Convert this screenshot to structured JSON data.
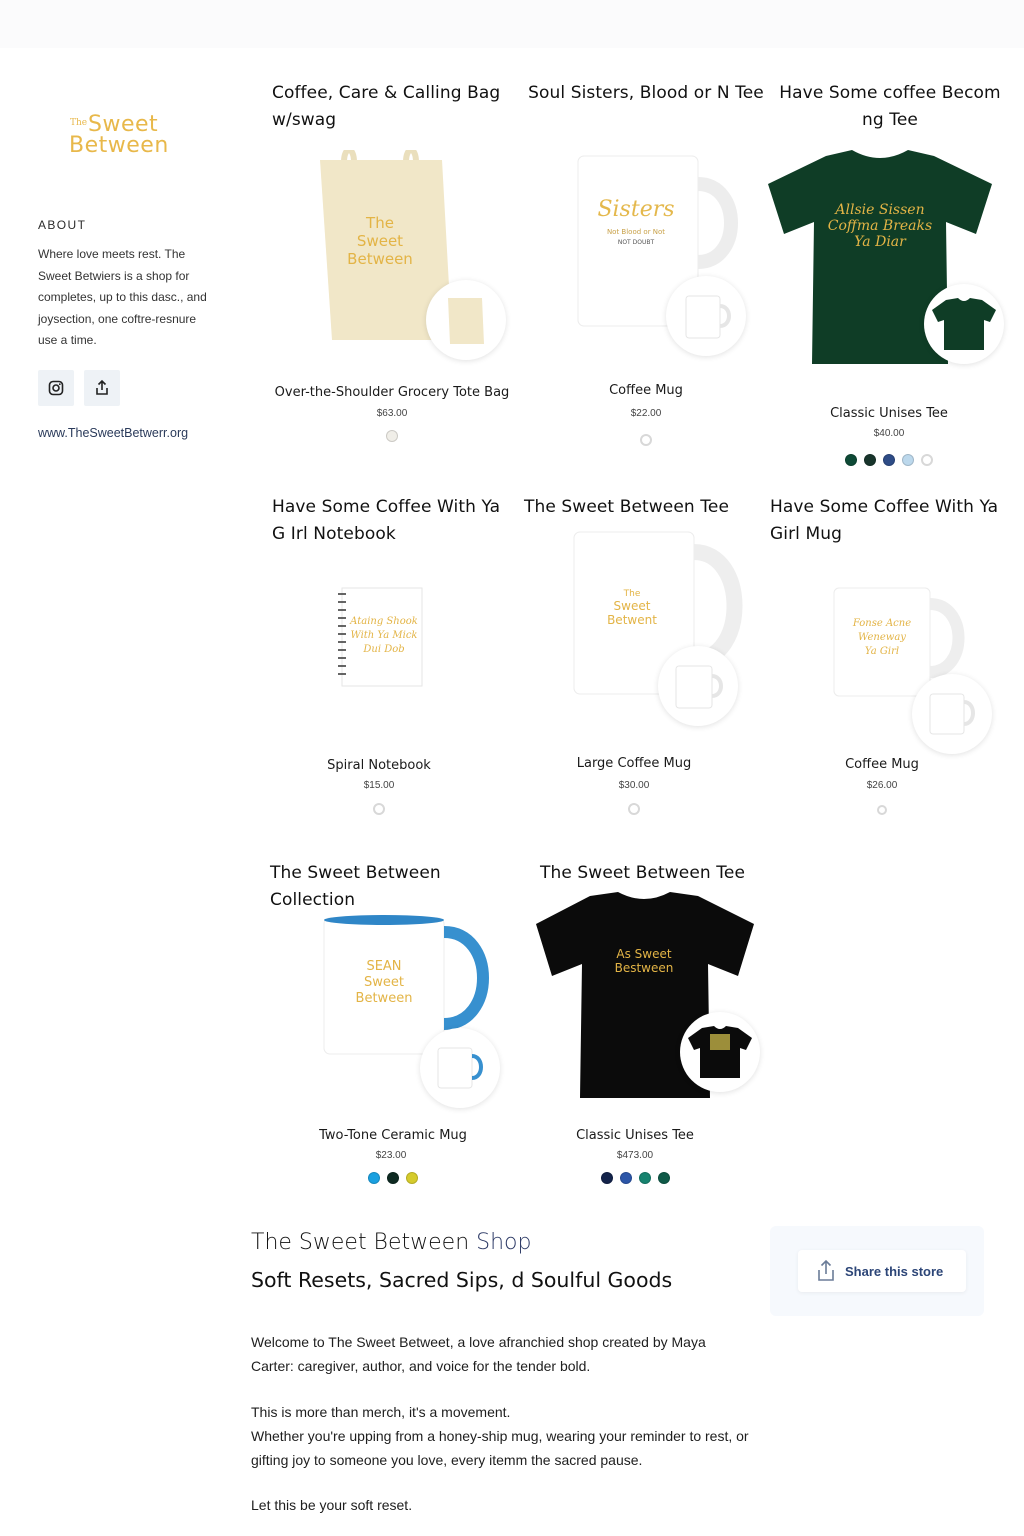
{
  "sidebar": {
    "logo": {
      "small": "The",
      "line1": "Sweet",
      "line2": "Between"
    },
    "about_heading": "ABOUT",
    "about_text": "Where love meets rest. The Sweet Betwiers is a shop for completes, up to this dasc., and joysection, one coftre-resnure use a time.",
    "website": "www.TheSweetBetwerr.org",
    "icons": [
      "instagram-icon",
      "share-icon"
    ]
  },
  "products": [
    {
      "title": "Coffee, Care & Calling Bag w/swag",
      "name": "Over-the-Shoulder Grocery Tote Bag",
      "price": "$63.00",
      "swatches": [
        "#f0eee8"
      ]
    },
    {
      "title": "Soul Sisters, Blood or N Tee",
      "name": "Coffee Mug",
      "price": "$22.00",
      "swatches": [
        "#ffffff"
      ]
    },
    {
      "title": "Have Some coffee Becom ng Tee",
      "name": "Classic Unises Tee",
      "price": "$40.00",
      "swatches": [
        "#0e4a36",
        "#18352c",
        "#2e4c86",
        "#bcd8ec",
        "#ffffff"
      ]
    },
    {
      "title": "Have Some Coffee With Ya G Irl Notebook",
      "name": "Spiral Notebook",
      "price": "$15.00",
      "swatches": [
        "#ffffff"
      ]
    },
    {
      "title": "The Sweet Between Tee",
      "name": "Large Coffee Mug",
      "price": "$30.00",
      "swatches": [
        "#ffffff"
      ]
    },
    {
      "title": "Have Some Coffee With Ya Girl Mug",
      "name": "Coffee Mug",
      "price": "$26.00",
      "swatches": [
        "#ffffff"
      ]
    },
    {
      "title": "The Sweet Between Collection",
      "name": "Two-Tone Ceramic Mug",
      "price": "$23.00",
      "swatches": [
        "#1aa0e0",
        "#0e2a22",
        "#d5cb2c"
      ]
    },
    {
      "title": "The Sweet Between Tee",
      "name": "Classic Unises Tee",
      "price": "$473.00",
      "swatches": [
        "#13234a",
        "#2c56a8",
        "#17836f",
        "#0f5a48"
      ]
    }
  ],
  "design_text": {
    "tote": [
      "The",
      "Sweet",
      "Between"
    ],
    "sisters_mug": [
      "Sisters",
      "Not Blood or Not",
      "NOT DOUBT"
    ],
    "green_tee": [
      "Allsie Sissen",
      "Coffma Breaks",
      "Ya Diar"
    ],
    "large_mug": [
      "The",
      "Sweet",
      "Betwent"
    ],
    "notebook": [
      "Ataing Shook",
      "With Ya Mick",
      "Dui Dob"
    ],
    "small_mug": [
      "Fonse Acne",
      "Weneway",
      "Ya Girl"
    ],
    "two_tone": [
      "SEAN",
      "Sweet",
      "Between"
    ],
    "black_tee": [
      "As Sweet",
      "Bestween"
    ]
  },
  "shop": {
    "heading_part1": "The Sweet Between ",
    "heading_accent": "Shop",
    "subheading": "Soft Resets, Sacred Sips, d Soulful Goods",
    "p1": "Welcome to The Sweet Betweet, a love afranchied shop created by Maya Carter: caregiver, author, and voice for the tender bold.",
    "p2": "This is more than merch, it's a movement.\nWhether you're upping from a honey-ship mug, wearing your reminder to rest, or gifting joy to someone you love, every itemm the sacred pause.",
    "p3": "Let this be your soft reset.",
    "share_label": "Share this store"
  },
  "colors": {
    "gold": "#e8b84a",
    "navy_accent": "#2d3a66",
    "share_text": "#2c4577"
  }
}
